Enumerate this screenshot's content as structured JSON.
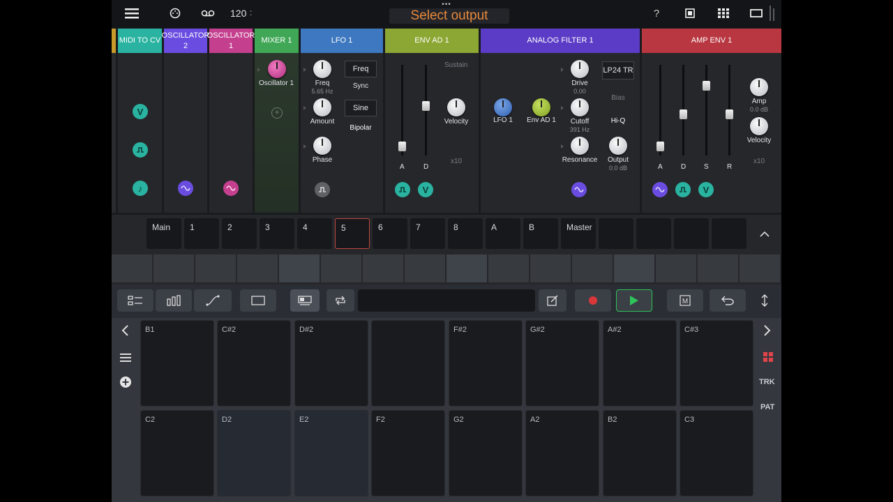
{
  "topbar": {
    "title": "Select output",
    "bpm": "120",
    "dots": "•••"
  },
  "modules": [
    {
      "label": "MIDI TO CV",
      "color": "#29b3a0"
    },
    {
      "label": "OSCILLATOR 2",
      "color": "#6a4de0"
    },
    {
      "label": "OSCILLATOR 1",
      "color": "#c4408f"
    },
    {
      "label": "MIXER 1",
      "color": "#3fa755"
    },
    {
      "label": "LFO 1",
      "color": "#3d78c0"
    },
    {
      "label": "ENV AD 1",
      "color": "#8da734"
    },
    {
      "label": "ANALOG FILTER 1",
      "color": "#5b3cc6"
    },
    {
      "label": "AMP ENV 1",
      "color": "#b83740"
    }
  ],
  "midi_badges": [
    "V",
    "⎍",
    "♪"
  ],
  "mixer": {
    "knob_label": "Oscillator 1"
  },
  "lfo": {
    "freq_label": "Freq",
    "freq_value": "5.65 Hz",
    "amount_label": "Amount",
    "phase_label": "Phase",
    "freq_box": "Freq",
    "sync_label": "Sync",
    "sine_box": "Sine",
    "bipolar_label": "Bipolar"
  },
  "envad": {
    "sustain_label": "Sustain",
    "a_label": "A",
    "d_label": "D",
    "velocity_label": "Velocity",
    "x10_label": "x10",
    "a_level": 0.05,
    "d_level": 0.55
  },
  "filter": {
    "lfo_label": "LFO 1",
    "env_label": "Env AD 1",
    "drive_label": "Drive",
    "drive_value": "0.00",
    "cutoff_label": "Cutoff",
    "cutoff_value": "391 Hz",
    "resonance_label": "Resonance",
    "type_box": "LP24 TR",
    "bias_label": "Bias",
    "hiq_label": "Hi-Q",
    "output_label": "Output",
    "output_value": "0.0 dB"
  },
  "ampenv": {
    "a_label": "A",
    "d_label": "D",
    "s_label": "S",
    "r_label": "R",
    "amp_label": "Amp",
    "amp_value": "0.0 dB",
    "velocity_label": "Velocity",
    "x10_label": "x10",
    "a_level": 0.05,
    "d_level": 0.45,
    "s_level": 0.8,
    "r_level": 0.45
  },
  "tracks": [
    "Main",
    "1",
    "2",
    "3",
    "4",
    "5",
    "6",
    "7",
    "8",
    "A",
    "B",
    "Master",
    "",
    "",
    "",
    ""
  ],
  "selected_track": "5",
  "pads_top": [
    "B1",
    "C#2",
    "D#2",
    "",
    "F#2",
    "G#2",
    "A#2",
    "C#3"
  ],
  "pads_bottom": [
    "C2",
    "D2",
    "E2",
    "F2",
    "G2",
    "A2",
    "B2",
    "C3"
  ],
  "side": {
    "trk_label": "TRK",
    "pat_label": "PAT"
  },
  "colors": {
    "accent_title": "#e8893a",
    "record": "#d9383a",
    "play": "#2fc45a",
    "selected_track_border": "#c2463f"
  }
}
